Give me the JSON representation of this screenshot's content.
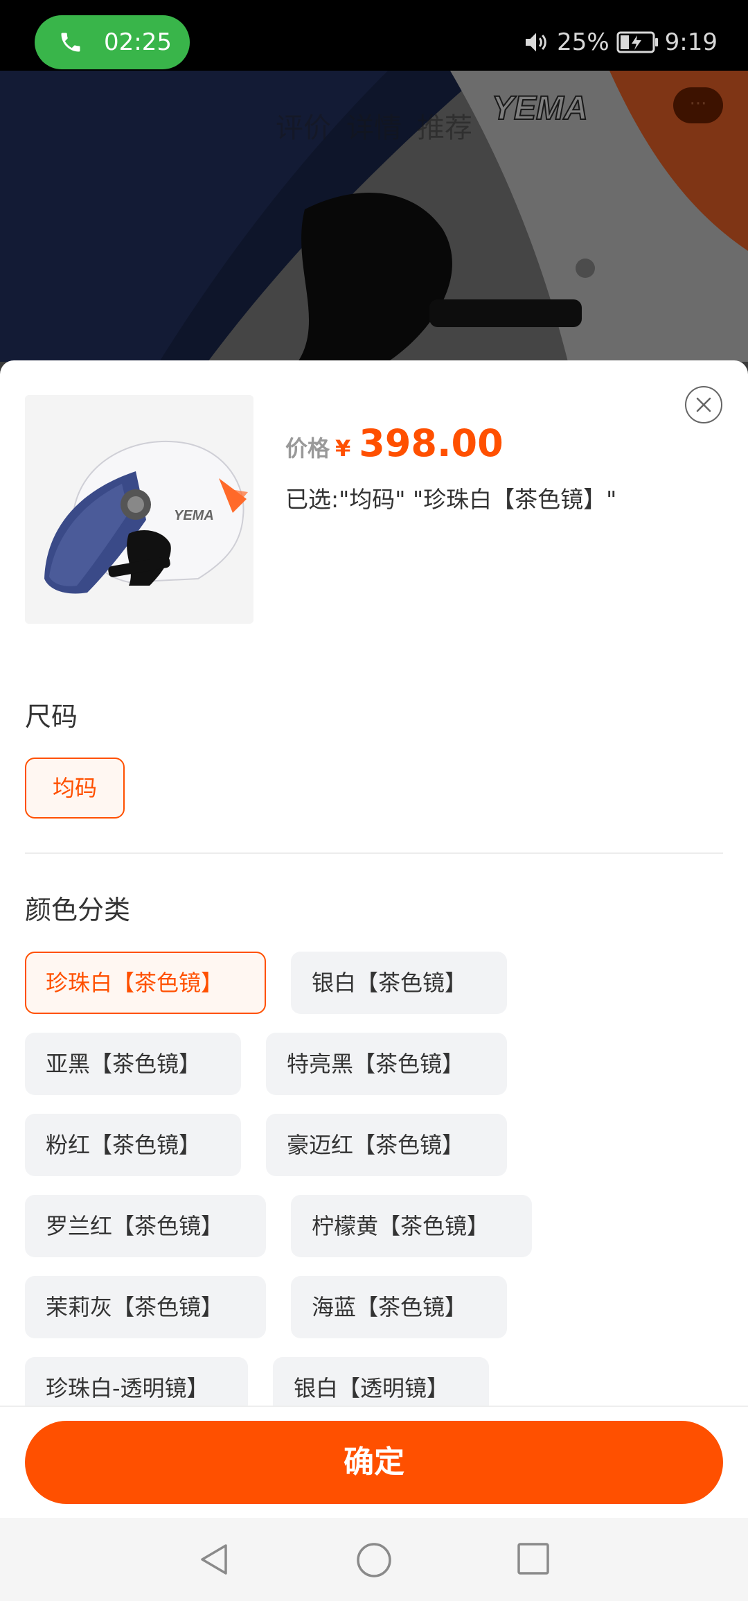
{
  "status_bar": {
    "call_time": "02:25",
    "battery_percent": "25%",
    "clock": "9:19",
    "icons": [
      "phone-icon",
      "speaker-icon",
      "battery-charging-icon"
    ]
  },
  "background_page": {
    "tabs": [
      "评价",
      "详情",
      "推荐"
    ],
    "more_label": "···",
    "brand_text": "YEMA"
  },
  "sheet": {
    "price_label": "价格",
    "currency": "¥",
    "price": "398.00",
    "selected_text": "已选:\"均码\" \"珍珠白【茶色镜】\"",
    "size_section": {
      "title": "尺码",
      "options": [
        "均码"
      ],
      "selected": "均码"
    },
    "color_section": {
      "title": "颜色分类",
      "options": [
        "珍珠白【茶色镜】",
        "银白【茶色镜】",
        "亚黑【茶色镜】",
        "特亮黑【茶色镜】",
        "粉红【茶色镜】",
        "豪迈红【茶色镜】",
        "罗兰红【茶色镜】",
        "柠檬黄【茶色镜】",
        "茉莉灰【茶色镜】",
        "海蓝【茶色镜】",
        "珍珠白-透明镜】",
        "银白【透明镜】"
      ],
      "selected": "珍珠白【茶色镜】"
    },
    "confirm_label": "确定"
  },
  "colors": {
    "accent": "#ff5000",
    "call_green": "#39b54a"
  }
}
